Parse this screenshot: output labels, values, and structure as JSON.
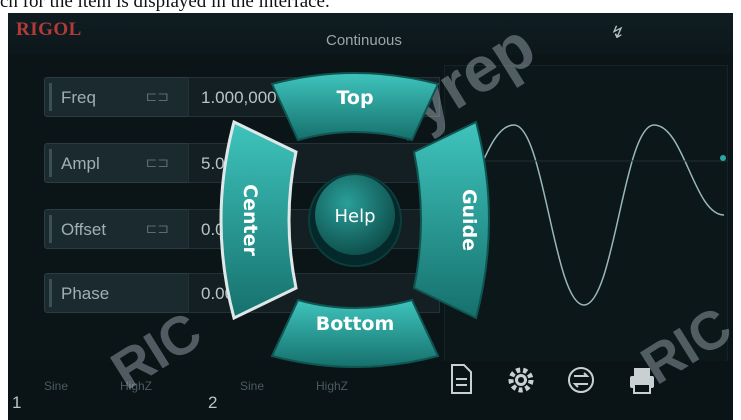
{
  "caption": "ch for the item is displayed in the interface.",
  "header": {
    "logo": "RIGOL",
    "mode": "Continuous",
    "mod_icon": "modulation-icon"
  },
  "params": [
    {
      "label": "Freq",
      "value": "1.000,000"
    },
    {
      "label": "Ampl",
      "value": "5.0 Vpp"
    },
    {
      "label": "Offset",
      "value": "0.0 Vdc"
    },
    {
      "label": "Phase",
      "value": "0.000 °"
    }
  ],
  "channels": [
    {
      "num": "1",
      "wave": "Sine",
      "load": "HighZ"
    },
    {
      "num": "2",
      "wave": "Sine",
      "load": "HighZ"
    }
  ],
  "help_menu": {
    "top": "Top",
    "bottom": "Bottom",
    "center": "Center",
    "guide": "Guide",
    "help": "Help"
  },
  "toolbar_icons": [
    "document-icon",
    "gear-icon",
    "sync-icon",
    "printer-icon"
  ],
  "colors": {
    "accent": "#2aa7a1",
    "screen_bg": "#0b1417",
    "logo": "#b43a36"
  }
}
